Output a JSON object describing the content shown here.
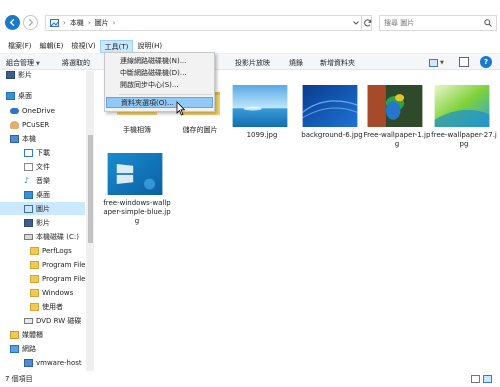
{
  "address": {
    "crumbs": [
      "本機",
      "圖片"
    ],
    "search_placeholder": "搜尋 圖片"
  },
  "menubar": {
    "items": [
      "檔案(F)",
      "編輯(E)",
      "檢視(V)",
      "工具(T)",
      "說明(H)"
    ],
    "active_index": 3
  },
  "toolbar": {
    "organize": "組合管理",
    "include": "將選取的",
    "slideshow": "投影片放映",
    "burn": "燒錄",
    "new_folder": "新增資料夾"
  },
  "tools_menu": {
    "items": [
      "連線網路磁碟機(N)...",
      "中斷網路磁碟機(D)...",
      "開啟同步中心(S)...",
      "資料夾選項(O)..."
    ],
    "highlighted_index": 3
  },
  "sidebar": {
    "items": [
      {
        "label": "影片",
        "icon": "video-folder-icon"
      },
      {
        "label": "桌面",
        "icon": "desktop-icon"
      },
      {
        "label": "OneDrive",
        "icon": "onedrive-cloud-icon"
      },
      {
        "label": "PCuSER",
        "icon": "user-icon"
      },
      {
        "label": "本機",
        "icon": "computer-icon"
      },
      {
        "label": "下載",
        "icon": "download-icon"
      },
      {
        "label": "文件",
        "icon": "document-icon"
      },
      {
        "label": "音樂",
        "icon": "music-icon"
      },
      {
        "label": "桌面",
        "icon": "desktop-icon"
      },
      {
        "label": "圖片",
        "icon": "pictures-icon"
      },
      {
        "label": "影片",
        "icon": "video-folder-icon"
      },
      {
        "label": "本機磁碟 (C:)",
        "icon": "drive-icon"
      },
      {
        "label": "PerfLogs",
        "icon": "folder-icon"
      },
      {
        "label": "Program File",
        "icon": "folder-icon"
      },
      {
        "label": "Program File",
        "icon": "folder-icon"
      },
      {
        "label": "Windows",
        "icon": "folder-icon"
      },
      {
        "label": "使用者",
        "icon": "folder-icon"
      },
      {
        "label": "DVD RW 磁碟",
        "icon": "dvd-drive-icon"
      },
      {
        "label": "媒體櫃",
        "icon": "library-icon"
      },
      {
        "label": "網路",
        "icon": "network-icon"
      },
      {
        "label": "vmware-host",
        "icon": "network-computer-icon"
      }
    ],
    "selected_index": 9
  },
  "files": [
    {
      "name": "手機相簿",
      "type": "folder"
    },
    {
      "name": "儲存的圖片",
      "type": "folder"
    },
    {
      "name": "1099.jpg",
      "type": "image",
      "style": "sea"
    },
    {
      "name": "background-6.jpg",
      "type": "image",
      "style": "blue-swirl"
    },
    {
      "name": "Free-wallpaper-1.jpg",
      "type": "image",
      "style": "parrot"
    },
    {
      "name": "free-wallpaper-27.jpg",
      "type": "image",
      "style": "green-wave"
    },
    {
      "name": "free-windows-wallpaper-simple-blue.jpg",
      "type": "image",
      "style": "simple-blue"
    }
  ],
  "status": {
    "count": "7 個項目"
  },
  "colors": {
    "accent": "#1979ca",
    "selection": "#cce8ff",
    "menu_highlight": "#91c9f7"
  }
}
